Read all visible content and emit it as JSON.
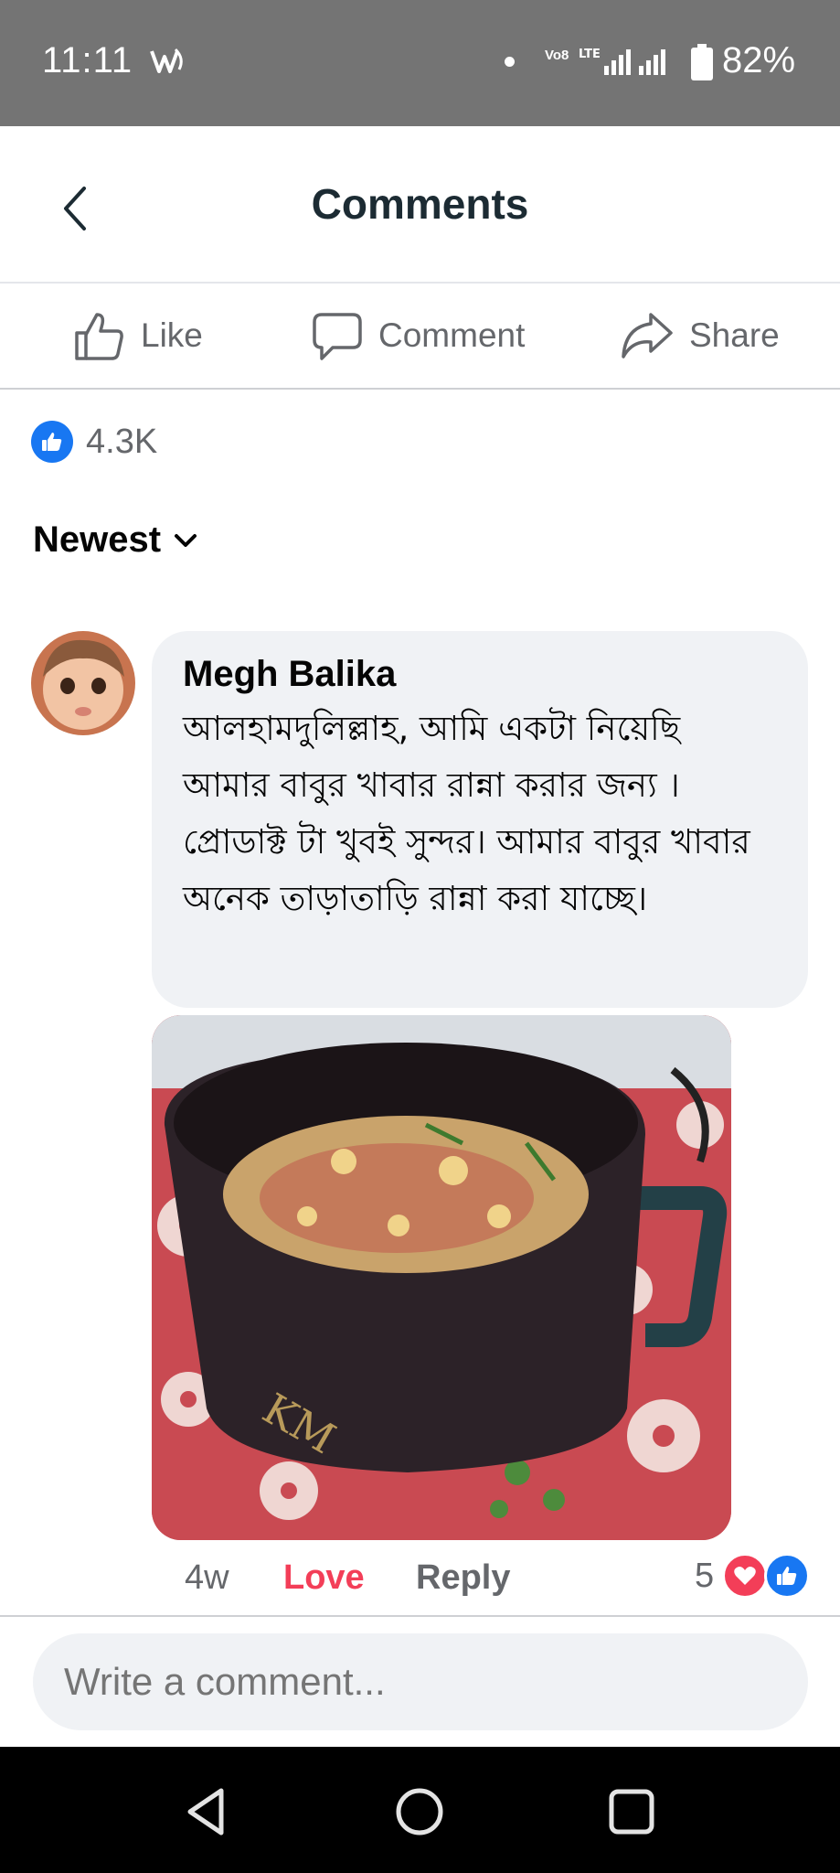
{
  "status_bar": {
    "time": "11:11",
    "volte_top": "Vo8",
    "volte_bottom": "LTE",
    "battery": "82%",
    "icons": [
      "notification-icon",
      "signal-icon",
      "battery-icon"
    ]
  },
  "header": {
    "title": "Comments",
    "back_icon": "chevron-left-icon"
  },
  "actions": {
    "like_label": "Like",
    "comment_label": "Comment",
    "share_label": "Share"
  },
  "post_reactions": {
    "count": "4.3K",
    "icon": "like-icon"
  },
  "sort": {
    "label": "Newest",
    "icon": "chevron-down-icon"
  },
  "comment": {
    "author": "Megh Balika",
    "text": "আলহামদুলিল্লাহ, আমি একটা নিয়েছি আমার বাবুর খাবার রান্না করার জন্য । প্রোডাক্ট টা খুবই সুন্দর। আমার বাবুর খাবার অনেক তাড়াতাড়ি রান্না করা যাচ্ছে।",
    "age": "4w",
    "love_label": "Love",
    "reply_label": "Reply",
    "reaction_count": "5",
    "reaction_icons": [
      "love-icon",
      "like-icon"
    ]
  },
  "composer": {
    "placeholder": "Write a comment..."
  },
  "colors": {
    "status_bar": "#747474",
    "facebook_blue": "#1877f2",
    "love_red": "#f33e58",
    "bubble_gray": "#f0f2f5",
    "secondary_text": "#65676b"
  }
}
